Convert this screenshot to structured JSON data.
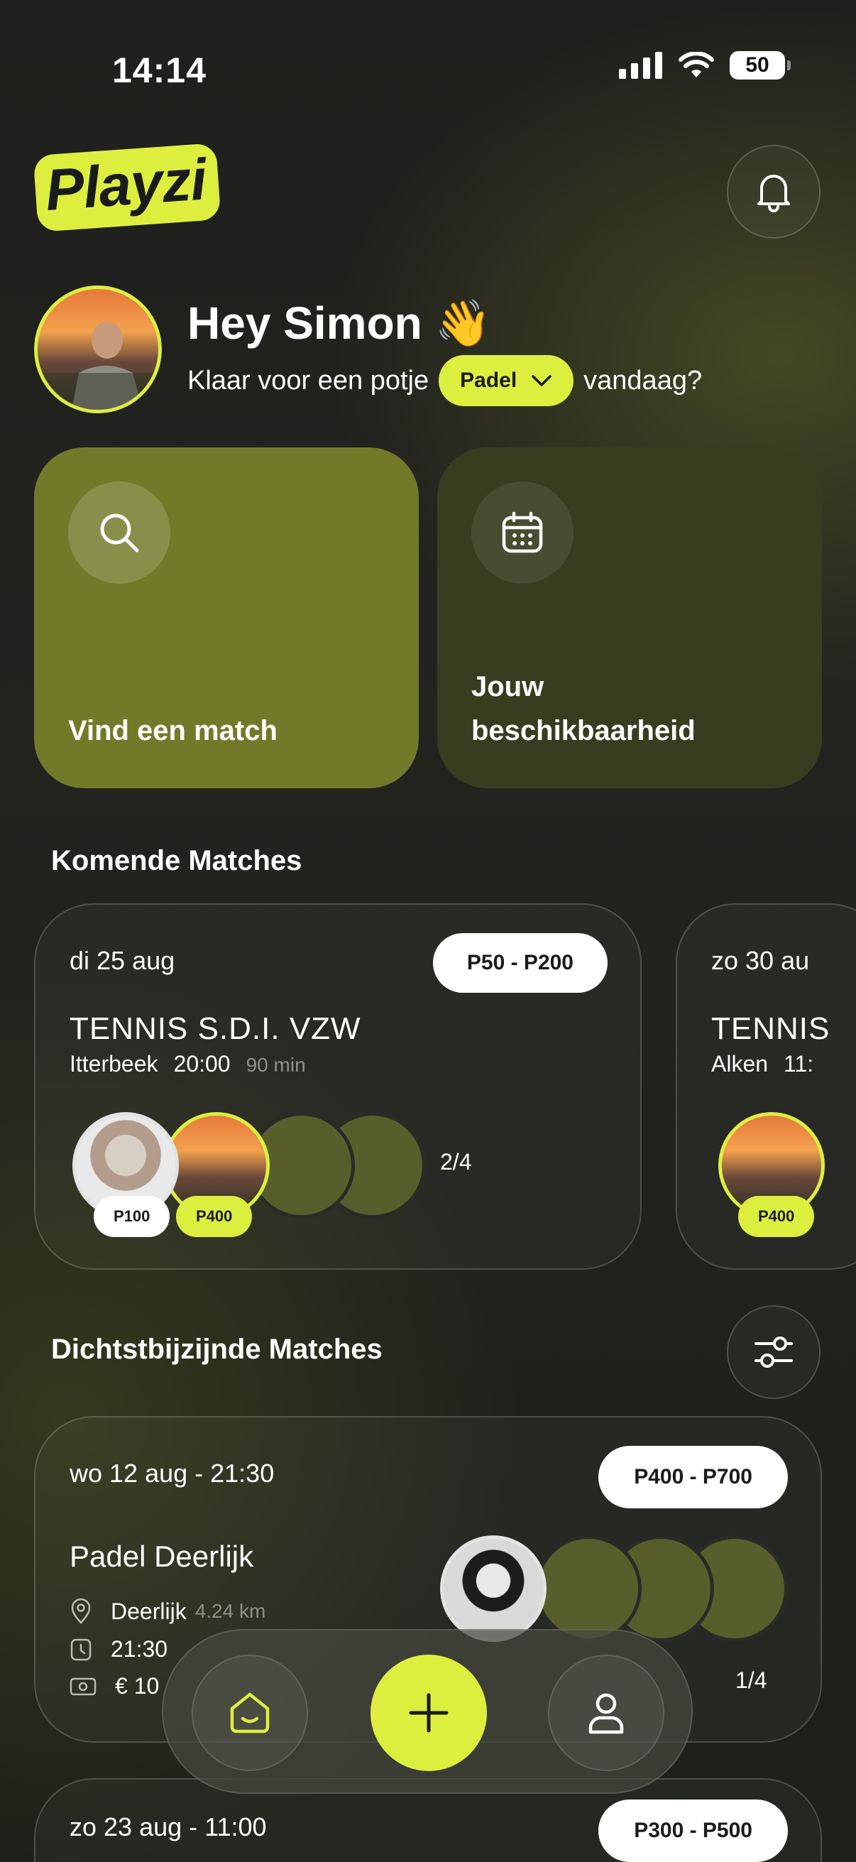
{
  "status_bar": {
    "time": "14:14",
    "battery": "50"
  },
  "header": {
    "logo": "Playzi"
  },
  "greeting": {
    "title": "Hey Simon 👋",
    "sub_before": "Klaar voor een potje",
    "sport": "Padel",
    "sub_after": "vandaag?"
  },
  "actions": {
    "find_match": "Vind een match",
    "availability": "Jouw beschikbaarheid"
  },
  "upcoming": {
    "title": "Komende Matches",
    "cards": [
      {
        "date": "di 25 aug",
        "level_range": "P50 - P200",
        "club": "TENNIS S.D.I. VZW",
        "location": "Itterbeek",
        "time": "20:00",
        "duration": "90 min",
        "player_levels": [
          "P100",
          "P400"
        ],
        "count": "2/4"
      },
      {
        "date": "zo 30 au",
        "club": "TENNIS",
        "location": "Alken",
        "time": "11:",
        "player_levels": [
          "P400"
        ]
      }
    ]
  },
  "nearby": {
    "title": "Dichtstbijzijnde Matches",
    "cards": [
      {
        "date": "wo 12 aug - 21:30",
        "level_range": "P400 - P700",
        "club": "Padel Deerlijk",
        "location": "Deerlijk",
        "distance": "4.24 km",
        "time": "21:30",
        "price": "€ 10",
        "count": "1/4"
      },
      {
        "date": "zo 23 aug - 11:00",
        "level_range": "P300 - P500"
      }
    ]
  },
  "colors": {
    "accent": "#dcef3f",
    "card_find": "#717a28",
    "card_avail": "#393d1f"
  }
}
